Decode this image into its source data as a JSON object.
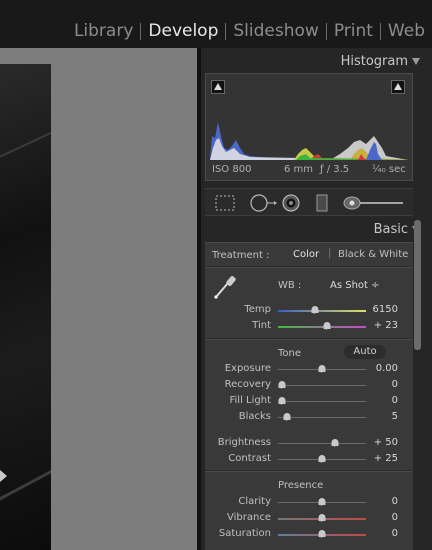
{
  "module_picker": [
    "Library",
    "Develop",
    "Slideshow",
    "Print",
    "Web"
  ],
  "active_module": "Develop",
  "histogram": {
    "title": "Histogram",
    "iso": "ISO 800",
    "focal_length": "6 mm",
    "aperture": "ƒ / 3.5",
    "shutter": "¹⁄₄₀ sec"
  },
  "basic": {
    "title": "Basic",
    "treatment_label": "Treatment :",
    "treatment_options": [
      "Color",
      "Black & White"
    ],
    "treatment_selected": "Color",
    "wb_label": "WB :",
    "wb_value": "As Shot ÷",
    "tone_label": "Tone",
    "auto_label": "Auto",
    "presence_label": "Presence",
    "sliders": {
      "temp": {
        "label": "Temp",
        "value": "6150",
        "fraction": 0.42
      },
      "tint": {
        "label": "Tint",
        "value": "+ 23",
        "fraction": 0.56
      },
      "exposure": {
        "label": "Exposure",
        "value": "0.00",
        "fraction": 0.5
      },
      "recovery": {
        "label": "Recovery",
        "value": "0",
        "fraction": 0.05
      },
      "fill_light": {
        "label": "Fill Light",
        "value": "0",
        "fraction": 0.05
      },
      "blacks": {
        "label": "Blacks",
        "value": "5",
        "fraction": 0.1
      },
      "brightness": {
        "label": "Brightness",
        "value": "+ 50",
        "fraction": 0.65
      },
      "contrast": {
        "label": "Contrast",
        "value": "+ 25",
        "fraction": 0.5
      },
      "clarity": {
        "label": "Clarity",
        "value": "0",
        "fraction": 0.5
      },
      "vibrance": {
        "label": "Vibrance",
        "value": "0",
        "fraction": 0.5
      },
      "saturation": {
        "label": "Saturation",
        "value": "0",
        "fraction": 0.5
      }
    }
  },
  "tools": [
    "crop-overlay-icon",
    "spot-removal-icon",
    "red-eye-icon",
    "graduated-filter-icon",
    "adjustment-brush-icon"
  ],
  "colors": {
    "panel_bg": "#393939",
    "top_bar": "#191919",
    "work_area": "#7d7d7d"
  }
}
